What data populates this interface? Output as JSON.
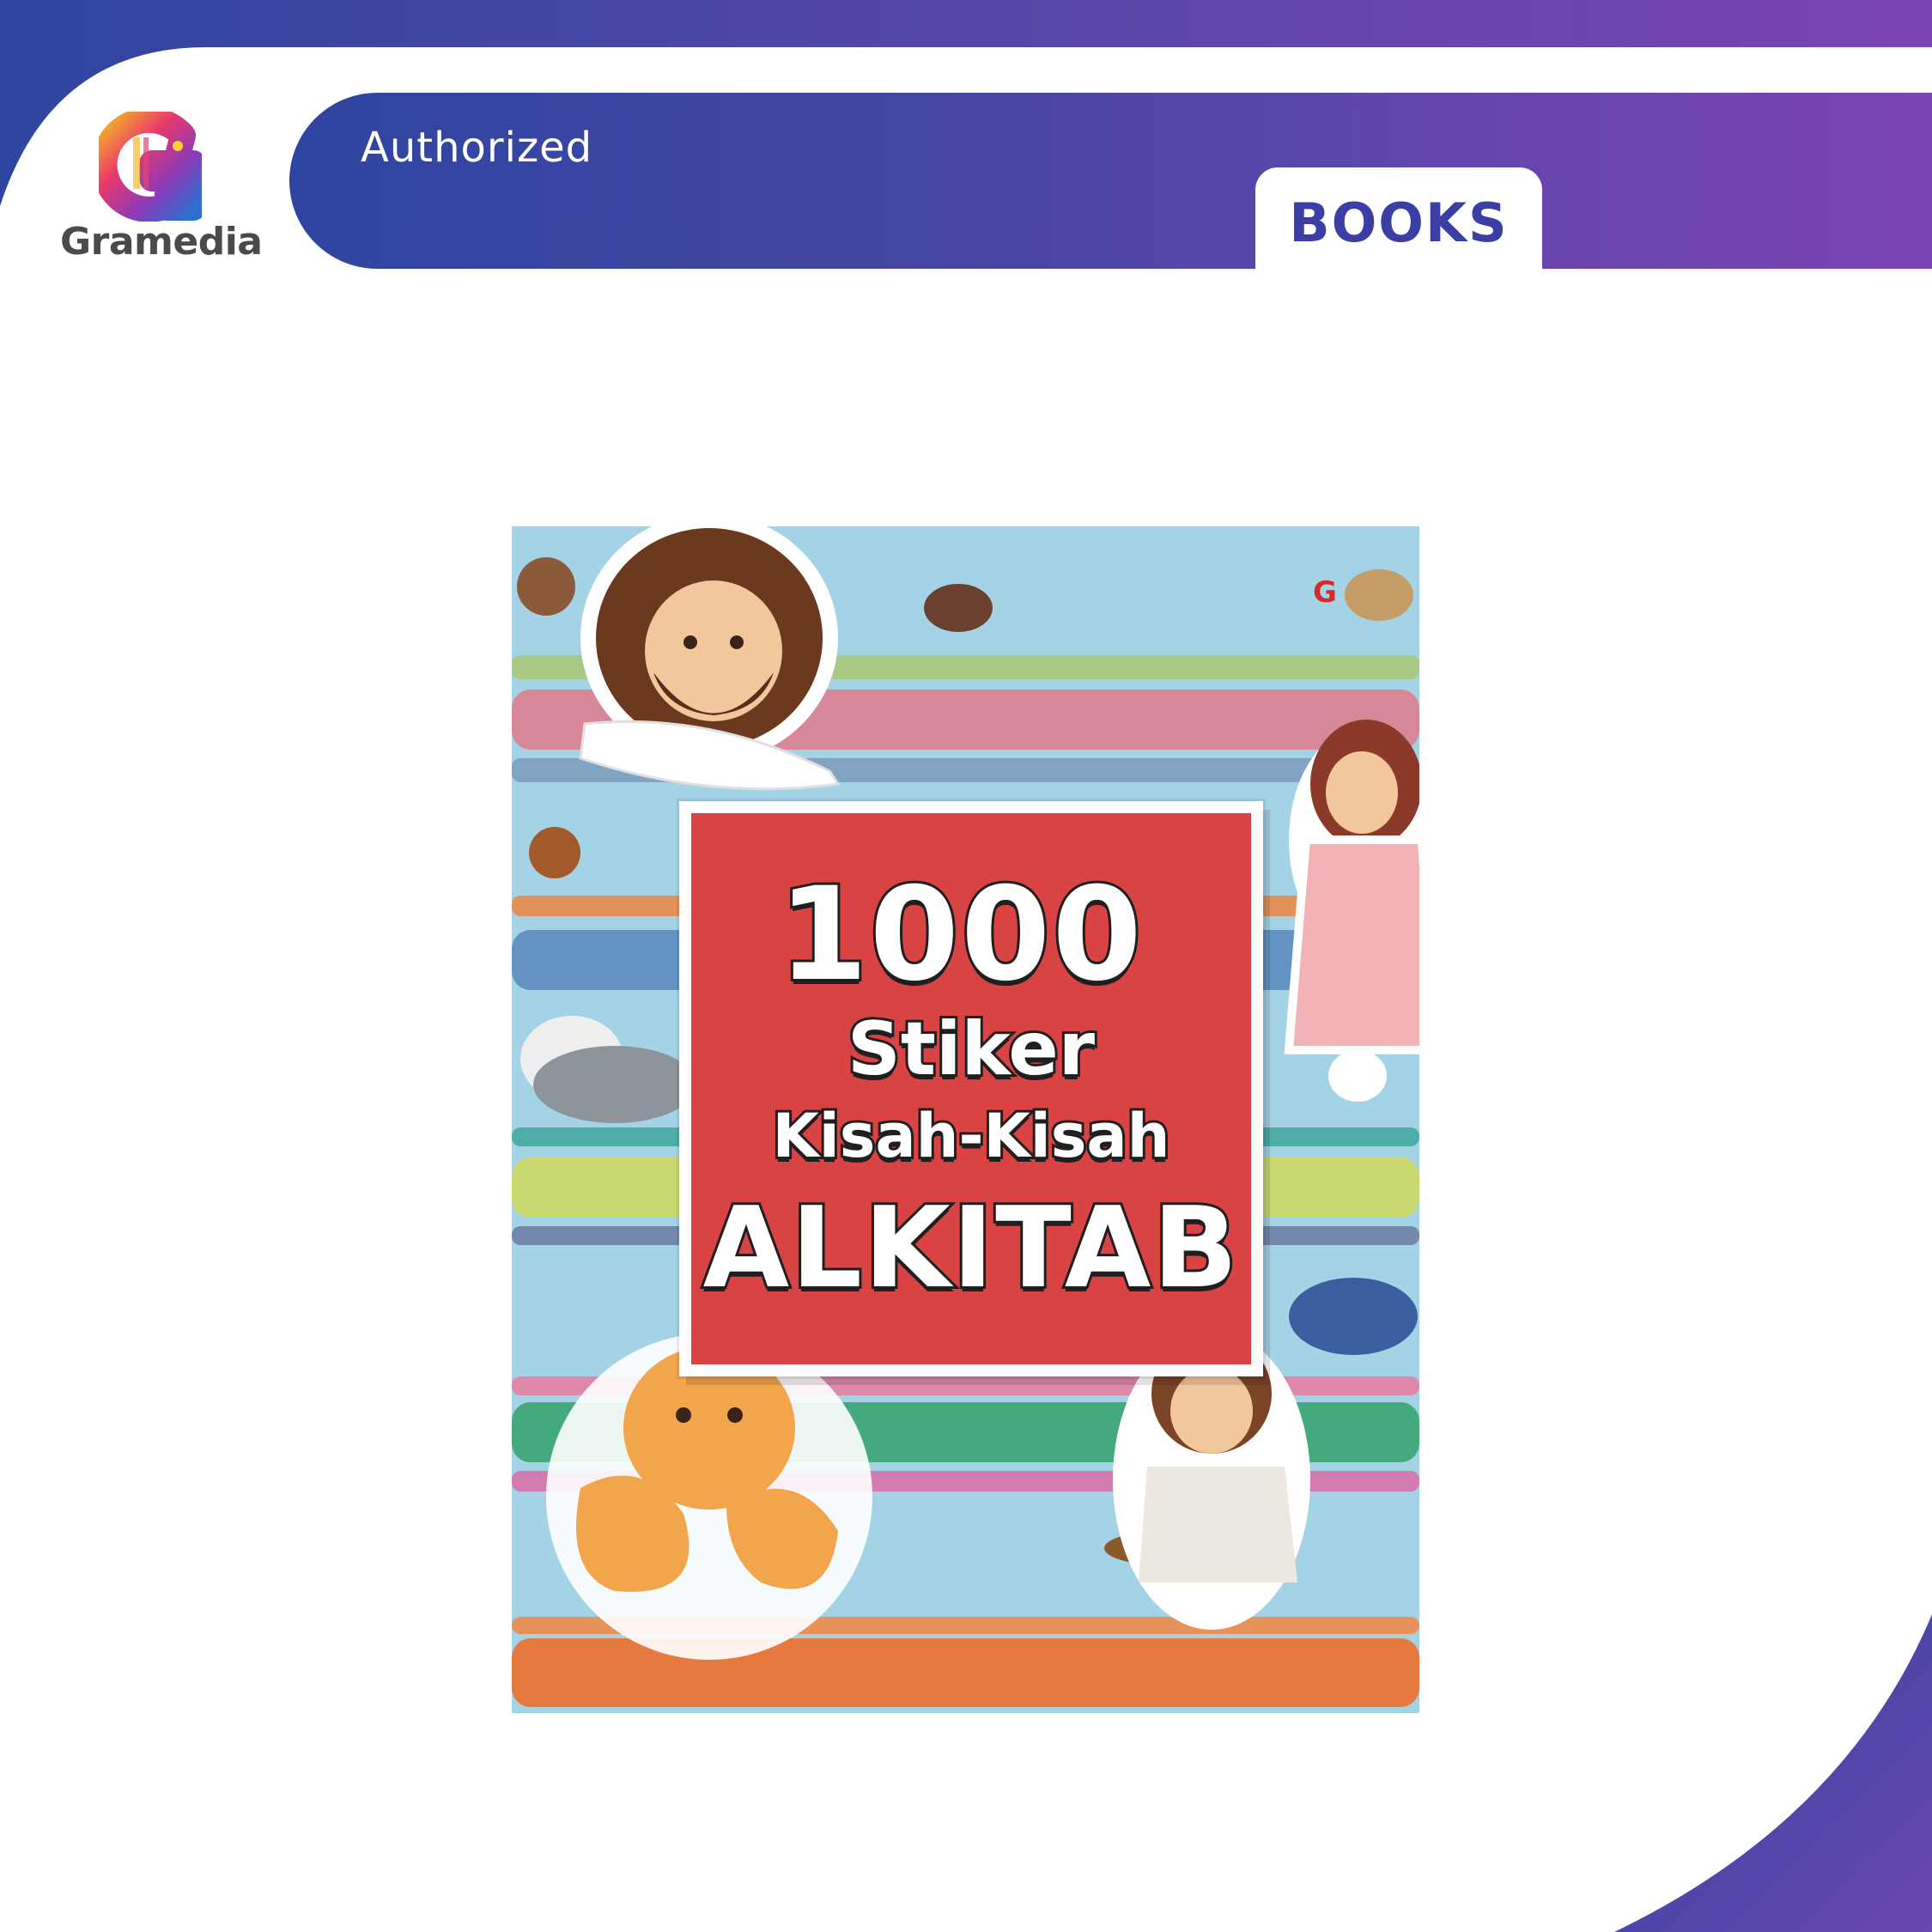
{
  "brand": {
    "logo_name": "Gramedia",
    "banner_text": "Authorized",
    "category_tab": "BOOKS"
  },
  "colors": {
    "banner_start": "#2e45a0",
    "banner_end": "#7a44b6",
    "tab_text": "#3b3fa5",
    "cover_background": "#a5d3e6",
    "title_panel": "#d94344"
  },
  "book": {
    "title_lines": [
      "1000",
      "Stiker",
      "Kisah-Kisah",
      "ALKITAB"
    ],
    "publisher_mark": "G"
  },
  "icons": [
    "gramedia-logo-icon"
  ]
}
